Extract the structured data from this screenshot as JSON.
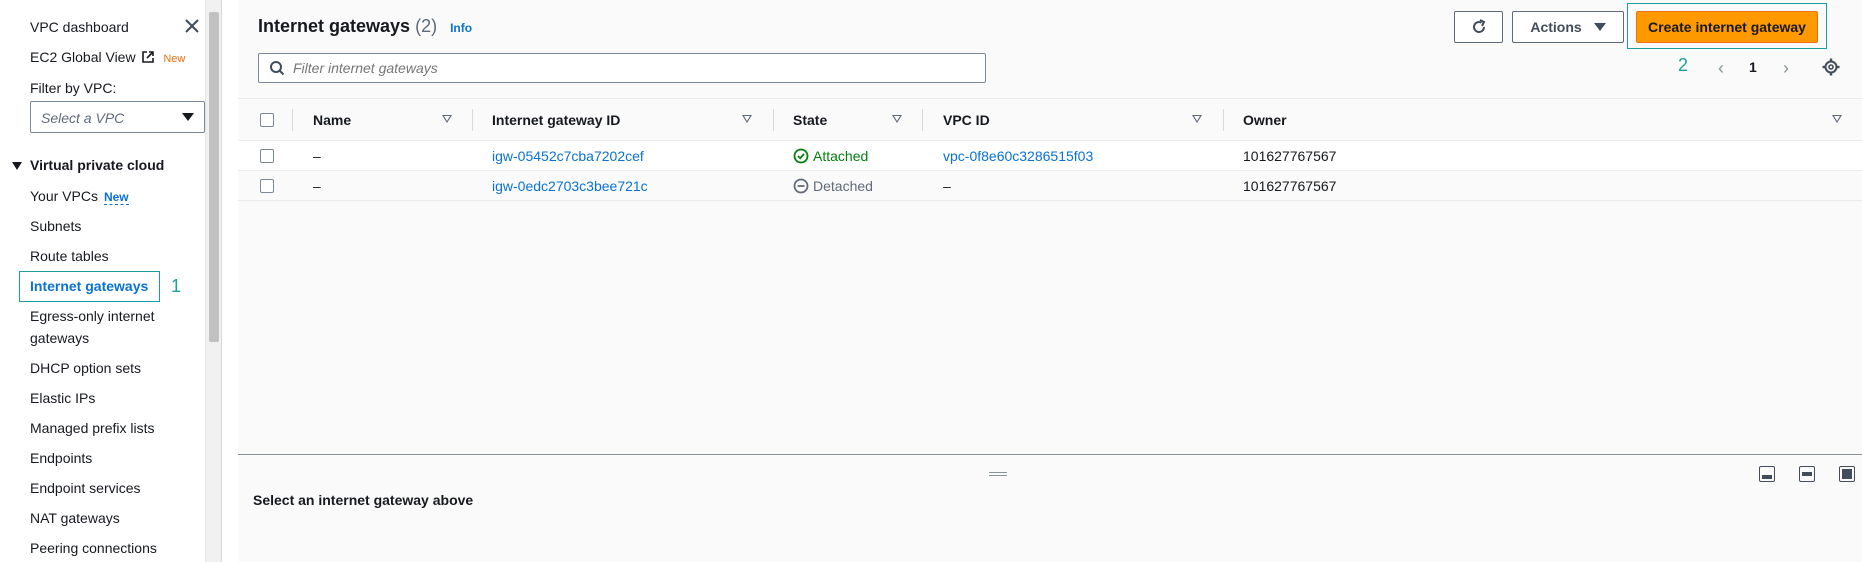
{
  "sidebar": {
    "dashboard": "VPC dashboard",
    "ec2_global_view": "EC2 Global View",
    "ec2_new_badge": "New",
    "filter_label": "Filter by VPC:",
    "filter_placeholder": "Select a VPC",
    "section_title": "Virtual private cloud",
    "items": [
      {
        "label": "Your VPCs",
        "badge": "New"
      },
      {
        "label": "Subnets"
      },
      {
        "label": "Route tables"
      },
      {
        "label": "Internet gateways",
        "active": true
      },
      {
        "label": "Egress-only internet"
      },
      {
        "label": "gateways"
      },
      {
        "label": "DHCP option sets"
      },
      {
        "label": "Elastic IPs"
      },
      {
        "label": "Managed prefix lists"
      },
      {
        "label": "Endpoints"
      },
      {
        "label": "Endpoint services"
      },
      {
        "label": "NAT gateways"
      },
      {
        "label": "Peering connections"
      }
    ],
    "step_marker": "1"
  },
  "header": {
    "title": "Internet gateways",
    "count": "(2)",
    "info": "Info",
    "actions_label": "Actions",
    "create_label": "Create internet gateway",
    "step_marker": "2",
    "search_placeholder": "Filter internet gateways",
    "page_number": "1"
  },
  "table": {
    "columns": [
      "Name",
      "Internet gateway ID",
      "State",
      "VPC ID",
      "Owner"
    ],
    "rows": [
      {
        "name": "–",
        "id": "igw-05452c7cba7202cef",
        "state": "Attached",
        "vpc": "vpc-0f8e60c3286515f03",
        "owner": "101627767567"
      },
      {
        "name": "–",
        "id": "igw-0edc2703c3bee721c",
        "state": "Detached",
        "vpc": "–",
        "owner": "101627767567"
      }
    ]
  },
  "split_panel": {
    "title": "Select an internet gateway above"
  },
  "colors": {
    "primary": "#ff9900",
    "link": "#0972d3",
    "success": "#037f0c",
    "marker": "#1a9e9e"
  }
}
